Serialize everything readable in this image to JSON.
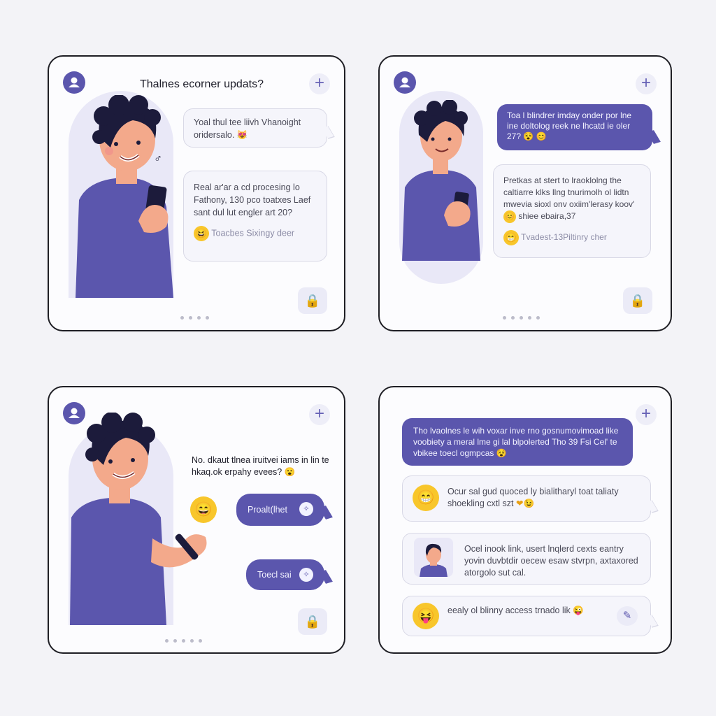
{
  "card1": {
    "title": "Thalnes ecorner updats?",
    "bubble_a": "Yoal thul tee liivh Vhanoight oridersalo.",
    "bubble_b": "Real ar'ar a cd procesing lo Fathony, 130 pco toatxes Laef sant dul lut engler art 20?",
    "bubble_b_footer": "Toacbes Sixingy deer",
    "emoji_laugh": "😆",
    "emoji_small": "😻",
    "ring_glyph": "♂",
    "lock_icon": "🔒",
    "plus": "+"
  },
  "card2": {
    "bubble_a": "Toa l blindrer imday onder por lne ine doltolog reek ne lhcatd ie oler 27?",
    "bubble_a_emoji": "😵 😊",
    "bubble_b": "Pretkas at stert to lraoklolng the caltiarre klks llng tnurimolh ol lidtn mwevia sioxl onv oxiim'lerasy koov'",
    "bubble_b_line4": "shiee ebaira,37",
    "bubble_b_footer": "Tvadest-13Piltinry cher",
    "emoji_smile": "😊",
    "emoji_grin": "😁",
    "lock_icon": "🔒",
    "plus": "+"
  },
  "card3": {
    "bubble_text": "No. dkaut tlnea iruitvei iams in lin te hkaq.ok erpahy evees?",
    "bubble_emoji": "😮",
    "pill_a": "Proalt(lhet",
    "pill_b": "Toecl sai",
    "emoji_big": "😄",
    "lock_icon": "🔒",
    "plus": "+"
  },
  "card4": {
    "bubble_a": "Tho lvaolnes le wih voxar inve rno gosnumovimoad like voobiety a meral lme gi lal blpolerted Tho 39 Fsi Cel' te vbikee toecl ogmpcas",
    "bubble_a_emoji": "😵",
    "bubble_b": "Ocur sal gud quoced ly bialitharyl toat taliaty shoekling cxtl szt",
    "bubble_b_emoji": "❤😉",
    "bubble_c": "Ocel inook link, usert lnqlerd cexts eantry yovin duvbtdir oecew esaw stvrpn, axtaxored atorgolo sut cal.",
    "bubble_d": "eealy ol blinny access trnado lik",
    "bubble_d_emoji": "😜",
    "emoji_a": "😁",
    "emoji_b": "😝",
    "edit_icon": "✎",
    "plus": "+"
  },
  "colors": {
    "accent": "#5b56ad",
    "accent_light": "#e9e8f7",
    "bubble_light": "#f5f5fb",
    "border": "#1e1e24",
    "background": "#f3f3f7"
  }
}
